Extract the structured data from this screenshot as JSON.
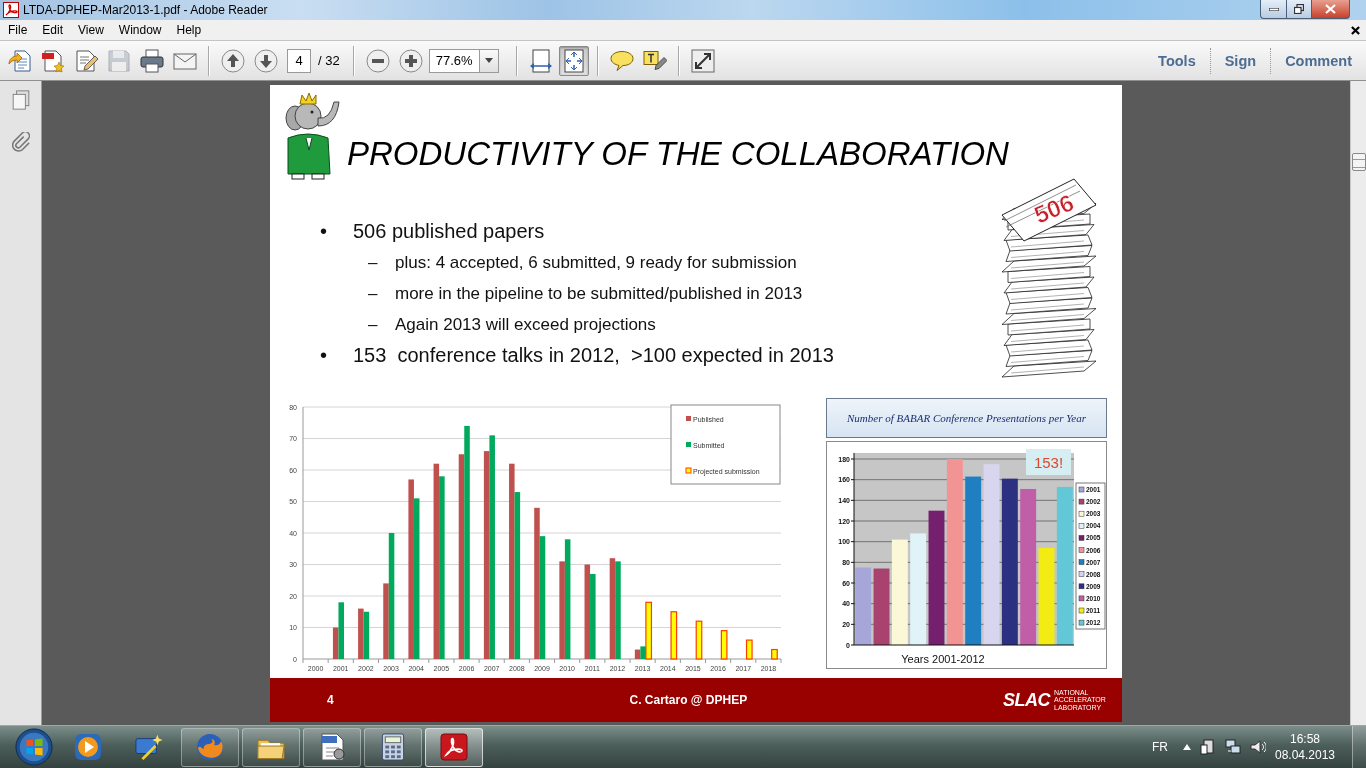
{
  "window": {
    "title": "LTDA-DPHEP-Mar2013-1.pdf - Adobe Reader"
  },
  "menu": [
    "File",
    "Edit",
    "View",
    "Window",
    "Help"
  ],
  "toolbar": {
    "file_tools": [
      {
        "kind": "create",
        "disabled": false
      },
      {
        "kind": "convert",
        "disabled": false
      },
      {
        "kind": "edit",
        "disabled": false
      },
      {
        "kind": "save",
        "disabled": true
      },
      {
        "kind": "print",
        "disabled": false
      },
      {
        "kind": "email",
        "disabled": false
      }
    ],
    "page_field": "4",
    "page_count": "/ 32",
    "zoom_field": "77.6%",
    "view_modes": [
      {
        "kind": "fit-width",
        "selected": false
      },
      {
        "kind": "fit-page",
        "selected": true
      }
    ],
    "panes": [
      "Tools",
      "Sign",
      "Comment"
    ]
  },
  "slide": {
    "title": "PRODUCTIVITY OF THE COLLABORATION",
    "bullets": [
      {
        "marker": "•",
        "text": "506 published papers",
        "children": [
          {
            "marker": "–",
            "text": "plus: 4 accepted, 6 submitted, 9 ready for submission"
          },
          {
            "marker": "–",
            "text": "more in the pipeline to be submitted/published in 2013"
          },
          {
            "marker": "–",
            "text": "Again 2013 will exceed projections"
          }
        ]
      },
      {
        "marker": "•",
        "text": "153  conference talks in 2012,  >100 expected in 2013"
      }
    ],
    "stack_label": "506",
    "papers_chart": {
      "chart_data": {
        "type": "bar",
        "categories": [
          "2000",
          "2001",
          "2002",
          "2003",
          "2004",
          "2005",
          "2006",
          "2007",
          "2008",
          "2009",
          "2010",
          "2011",
          "2012",
          "2013",
          "2014",
          "2015",
          "2016",
          "2017",
          "2018"
        ],
        "series": [
          {
            "name": "Published",
            "color": "#c0504d",
            "values": [
              null,
              10,
              16,
              24,
              57,
              62,
              65,
              66,
              62,
              48,
              31,
              30,
              32,
              3,
              null,
              null,
              null,
              null,
              null
            ]
          },
          {
            "name": "Submitted",
            "color": "#00a95c",
            "values": [
              null,
              18,
              15,
              40,
              51,
              58,
              74,
              71,
              53,
              39,
              38,
              27,
              31,
              4,
              null,
              null,
              null,
              null,
              null
            ]
          },
          {
            "name": "Projected submission",
            "color": "#ffff00",
            "values": [
              null,
              null,
              null,
              null,
              null,
              null,
              null,
              null,
              null,
              null,
              null,
              null,
              null,
              18,
              15,
              12,
              9,
              6,
              3
            ]
          }
        ],
        "ylim": [
          0,
          80
        ],
        "yticks": [
          0,
          10,
          20,
          30,
          40,
          50,
          60,
          70,
          80
        ],
        "grid": true,
        "legend": "upper right"
      }
    },
    "presentations_chart": {
      "chart_data": {
        "type": "bar",
        "title": "Number of BABAR Conference Presentations per Year",
        "xlabel": "Years 2001-2012",
        "series": [
          {
            "name": "2001",
            "color": "#a6a6d8",
            "values": [
              75,
              null,
              null,
              null,
              null,
              null,
              null,
              null,
              null,
              null,
              null,
              null
            ]
          },
          {
            "name": "2002",
            "color": "#a8436f",
            "values": [
              null,
              74,
              null,
              null,
              null,
              null,
              null,
              null,
              null,
              null,
              null,
              null
            ]
          },
          {
            "name": "2003",
            "color": "#fbf8d8",
            "values": [
              null,
              null,
              102,
              null,
              null,
              null,
              null,
              null,
              null,
              null,
              null,
              null
            ]
          },
          {
            "name": "2004",
            "color": "#dff3f8",
            "values": [
              null,
              null,
              null,
              108,
              null,
              null,
              null,
              null,
              null,
              null,
              null,
              null
            ]
          },
          {
            "name": "2005",
            "color": "#74206e",
            "values": [
              null,
              null,
              null,
              null,
              130,
              null,
              null,
              null,
              null,
              null,
              null,
              null
            ]
          },
          {
            "name": "2006",
            "color": "#f39494",
            "values": [
              null,
              null,
              null,
              null,
              null,
              180,
              null,
              null,
              null,
              null,
              null,
              null
            ]
          },
          {
            "name": "2007",
            "color": "#1f7fc0",
            "values": [
              null,
              null,
              null,
              null,
              null,
              null,
              163,
              null,
              null,
              null,
              null,
              null
            ]
          },
          {
            "name": "2008",
            "color": "#d8d6ee",
            "values": [
              null,
              null,
              null,
              null,
              null,
              null,
              null,
              175,
              null,
              null,
              null,
              null
            ]
          },
          {
            "name": "2009",
            "color": "#2b3080",
            "values": [
              null,
              null,
              null,
              null,
              null,
              null,
              null,
              null,
              161,
              null,
              null,
              null
            ]
          },
          {
            "name": "2010",
            "color": "#c05fa8",
            "values": [
              null,
              null,
              null,
              null,
              null,
              null,
              null,
              null,
              null,
              151,
              null,
              null
            ]
          },
          {
            "name": "2011",
            "color": "#f2ec14",
            "values": [
              null,
              null,
              null,
              null,
              null,
              null,
              null,
              null,
              null,
              null,
              94,
              null
            ]
          },
          {
            "name": "2012",
            "color": "#62c8d8",
            "values": [
              null,
              null,
              null,
              null,
              null,
              null,
              null,
              null,
              null,
              null,
              null,
              153
            ]
          }
        ],
        "ylim": [
          0,
          180
        ],
        "yticks": [
          0,
          20,
          40,
          60,
          80,
          100,
          120,
          140,
          160,
          180
        ],
        "grid": true,
        "legend": "center right",
        "annotations": [
          {
            "text": "153!"
          }
        ]
      }
    },
    "footer": {
      "page_number": "4",
      "author": "C. Cartaro @ DPHEP",
      "logo": "SLAC",
      "logo_caption": "NATIONAL ACCELERATOR LABORATORY"
    }
  },
  "taskbar": {
    "apps": [
      {
        "kind": "media",
        "running": false,
        "selected": false
      },
      {
        "kind": "wand",
        "running": false,
        "selected": false
      },
      {
        "kind": "browser",
        "running": true,
        "selected": false
      },
      {
        "kind": "folder",
        "running": true,
        "selected": false
      },
      {
        "kind": "document",
        "running": true,
        "selected": false
      },
      {
        "kind": "calculator",
        "running": true,
        "selected": false
      },
      {
        "kind": "reader",
        "running": true,
        "selected": true
      }
    ],
    "language": "FR",
    "time": "16:58",
    "date": "08.04.2013"
  }
}
